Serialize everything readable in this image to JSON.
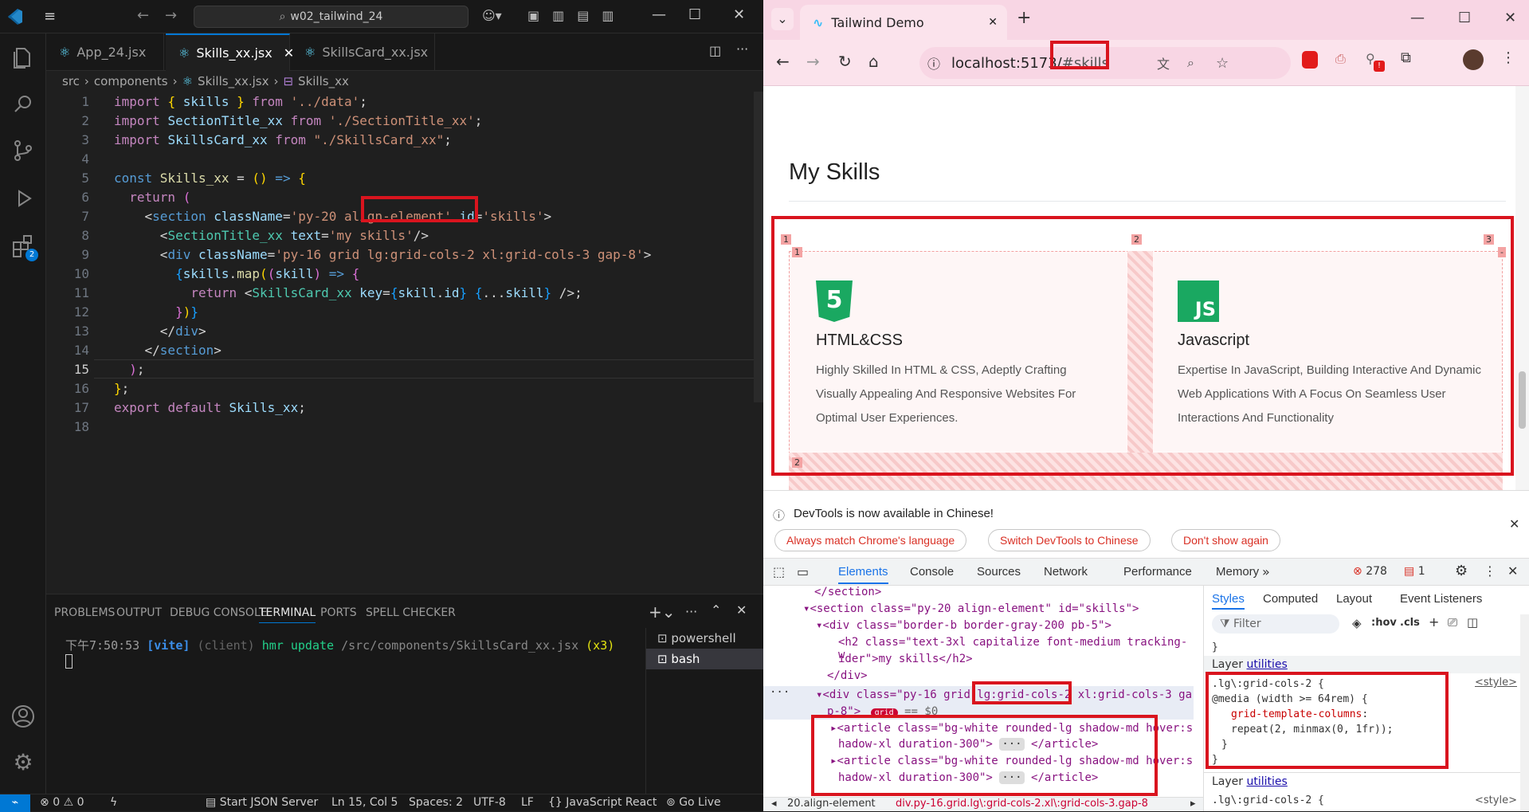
{
  "vscode": {
    "search_box": "w02_tailwind_24",
    "tabs": [
      {
        "label": "App_24.jsx"
      },
      {
        "label": "Skills_xx.jsx"
      },
      {
        "label": "SkillsCard_xx.jsx"
      }
    ],
    "breadcrumb": [
      "src",
      "components",
      "Skills_xx.jsx",
      "Skills_xx"
    ],
    "activity_badge": "2",
    "code_lines": [
      {
        "n": "1",
        "tokens": [
          [
            "kw",
            "import "
          ],
          [
            "br1",
            "{ "
          ],
          [
            "var",
            "skills"
          ],
          [
            "br1",
            " }"
          ],
          [
            "kw",
            " from "
          ],
          [
            "str",
            "'../data'"
          ],
          [
            "pun",
            ";"
          ]
        ]
      },
      {
        "n": "2",
        "tokens": [
          [
            "kw",
            "import "
          ],
          [
            "var",
            "SectionTitle_xx"
          ],
          [
            "kw",
            " from "
          ],
          [
            "str",
            "'./SectionTitle_xx'"
          ],
          [
            "pun",
            ";"
          ]
        ]
      },
      {
        "n": "3",
        "tokens": [
          [
            "kw",
            "import "
          ],
          [
            "var",
            "SkillsCard_xx"
          ],
          [
            "kw",
            " from "
          ],
          [
            "str",
            "\"./SkillsCard_xx\""
          ],
          [
            "pun",
            ";"
          ]
        ]
      },
      {
        "n": "4",
        "tokens": []
      },
      {
        "n": "5",
        "tokens": [
          [
            "kb",
            "const "
          ],
          [
            "fn",
            "Skills_xx"
          ],
          [
            "pun",
            " = "
          ],
          [
            "br1",
            "()"
          ],
          [
            "kb",
            " => "
          ],
          [
            "br1",
            "{"
          ]
        ]
      },
      {
        "n": "6",
        "tokens": [
          [
            "pun",
            "  "
          ],
          [
            "kw",
            "return "
          ],
          [
            "br2",
            "("
          ]
        ]
      },
      {
        "n": "7",
        "tokens": [
          [
            "pun",
            "    "
          ],
          [
            "pun",
            "<"
          ],
          [
            "kb",
            "section "
          ],
          [
            "attr",
            "className"
          ],
          [
            "pun",
            "="
          ],
          [
            "str",
            "'py-20 align-element'"
          ],
          [
            "attr",
            " id"
          ],
          [
            "pun",
            "="
          ],
          [
            "str",
            "'skills'"
          ],
          [
            "pun",
            ">"
          ]
        ]
      },
      {
        "n": "8",
        "tokens": [
          [
            "pun",
            "      "
          ],
          [
            "pun",
            "<"
          ],
          [
            "tag",
            "SectionTitle_xx "
          ],
          [
            "attr",
            "text"
          ],
          [
            "pun",
            "="
          ],
          [
            "str",
            "'my skills'"
          ],
          [
            "pun",
            "/>"
          ]
        ]
      },
      {
        "n": "9",
        "tokens": [
          [
            "pun",
            "      "
          ],
          [
            "pun",
            "<"
          ],
          [
            "kb",
            "div "
          ],
          [
            "attr",
            "className"
          ],
          [
            "pun",
            "="
          ],
          [
            "str",
            "'py-16 grid lg:grid-cols-2 xl:grid-cols-3 gap-8'"
          ],
          [
            "pun",
            ">"
          ]
        ]
      },
      {
        "n": "10",
        "tokens": [
          [
            "pun",
            "        "
          ],
          [
            "br3",
            "{"
          ],
          [
            "var",
            "skills"
          ],
          [
            "pun",
            "."
          ],
          [
            "fn",
            "map"
          ],
          [
            "br1",
            "("
          ],
          [
            "br2",
            "("
          ],
          [
            "var",
            "skill"
          ],
          [
            "br2",
            ")"
          ],
          [
            "kb",
            " => "
          ],
          [
            "br2",
            "{"
          ]
        ]
      },
      {
        "n": "11",
        "tokens": [
          [
            "pun",
            "          "
          ],
          [
            "kw",
            "return "
          ],
          [
            "pun",
            "<"
          ],
          [
            "tag",
            "SkillsCard_xx "
          ],
          [
            "attr",
            "key"
          ],
          [
            "pun",
            "="
          ],
          [
            "br3",
            "{"
          ],
          [
            "var",
            "skill"
          ],
          [
            "pun",
            "."
          ],
          [
            "var",
            "id"
          ],
          [
            "br3",
            "}"
          ],
          [
            "pun",
            " "
          ],
          [
            "br3",
            "{"
          ],
          [
            "pun",
            "..."
          ],
          [
            "var",
            "skill"
          ],
          [
            "br3",
            "}"
          ],
          [
            "pun",
            " />"
          ],
          [
            "pun",
            ";"
          ]
        ]
      },
      {
        "n": "12",
        "tokens": [
          [
            "pun",
            "        "
          ],
          [
            "br2",
            "}"
          ],
          [
            "br1",
            ")"
          ],
          [
            "br3",
            "}"
          ]
        ]
      },
      {
        "n": "13",
        "tokens": [
          [
            "pun",
            "      "
          ],
          [
            "pun",
            "</"
          ],
          [
            "kb",
            "div"
          ],
          [
            "pun",
            ">"
          ]
        ]
      },
      {
        "n": "14",
        "tokens": [
          [
            "pun",
            "    "
          ],
          [
            "pun",
            "</"
          ],
          [
            "kb",
            "section"
          ],
          [
            "pun",
            ">"
          ]
        ]
      },
      {
        "n": "15",
        "tokens": [
          [
            "pun",
            "  "
          ],
          [
            "br2",
            ")"
          ],
          [
            "pun",
            ";"
          ]
        ]
      },
      {
        "n": "16",
        "tokens": [
          [
            "br1",
            "}"
          ],
          [
            "pun",
            ";"
          ]
        ]
      },
      {
        "n": "17",
        "tokens": [
          [
            "kw",
            "export "
          ],
          [
            "kw",
            "default "
          ],
          [
            "var",
            "Skills_xx"
          ],
          [
            "pun",
            ";"
          ]
        ]
      },
      {
        "n": "18",
        "tokens": []
      }
    ],
    "panel_tabs": [
      "PROBLEMS",
      "OUTPUT",
      "DEBUG CONSOLE",
      "TERMINAL",
      "PORTS",
      "SPELL CHECKER"
    ],
    "terminal_line": {
      "time": "下午7:50:53",
      "vite": "[vite]",
      "client": "(client)",
      "msg": "hmr update",
      "path": "/src/components/SkillsCard_xx.jsx",
      "count": "(x3)"
    },
    "terminals": [
      "powershell",
      "bash"
    ],
    "status": {
      "errors": "0",
      "warnings": "0",
      "json_server": "Start JSON Server",
      "position": "Ln 15, Col 5",
      "spaces": "Spaces: 2",
      "encoding": "UTF-8",
      "eol": "LF",
      "language": "JavaScript React",
      "golive": "Go Live"
    }
  },
  "chrome": {
    "tab_title": "Tailwind Demo",
    "url_host": "localhost:5173/",
    "url_hash": "#skills",
    "ext_badge": "!",
    "page": {
      "heading": "My Skills",
      "cards": [
        {
          "icon": "5",
          "title": "HTML&CSS",
          "text": "Highly Skilled In HTML & CSS, Adeptly Crafting Visually Appealing And Responsive Websites For Optimal User Experiences."
        },
        {
          "icon": "JS",
          "title": "Javascript",
          "text": "Expertise In JavaScript, Building Interactive And Dynamic Web Applications With A Focus On Seamless User Interactions And Functionality"
        }
      ],
      "grid_labels": [
        "1",
        "2",
        "3",
        "1",
        "2",
        "-"
      ]
    },
    "banner": {
      "message": "DevTools is now available in Chinese!",
      "btn1": "Always match Chrome's language",
      "btn2": "Switch DevTools to Chinese",
      "btn3": "Don't show again"
    },
    "devtools": {
      "tabs": [
        "Elements",
        "Console",
        "Sources",
        "Network",
        "Performance",
        "Memory"
      ],
      "error_count": "278",
      "issue_count": "1",
      "dom": [
        "</section>",
        "<section class=\"py-20 align-element\" id=\"skills\">",
        "<div class=\"border-b border-gray-200 pb-5\">",
        "<h2 class=\"text-3xl capitalize font-medium tracking-w",
        "ider\">my skills</h2>",
        "</div>",
        "<div class=\"py-16 grid lg:grid-cols-2 xl:grid-cols-3 ga",
        "p-8\">",
        "grid",
        "== $0",
        "<article class=\"bg-white rounded-lg shadow-md hover:s",
        "hadow-xl duration-300\">",
        "</article>"
      ],
      "style_tabs": [
        "Styles",
        "Computed",
        "Layout",
        "Event Listeners"
      ],
      "filter_placeholder": "Filter",
      "hov": ":hov",
      "cls": ".cls",
      "layer_label": "Layer",
      "layer_name": "utilities",
      "rule_selector": ".lg\\:grid-cols-2 {",
      "rule_media": "@media (width >= 64rem) {",
      "rule_prop": "grid-template-columns",
      "rule_value": "repeat(2, minmax(0, 1fr));",
      "rule_source": "<style>",
      "crumb1": "20.align-element",
      "crumb2": "div.py-16.grid.lg\\:grid-cols-2.xl\\:grid-cols-3.gap-8"
    }
  }
}
